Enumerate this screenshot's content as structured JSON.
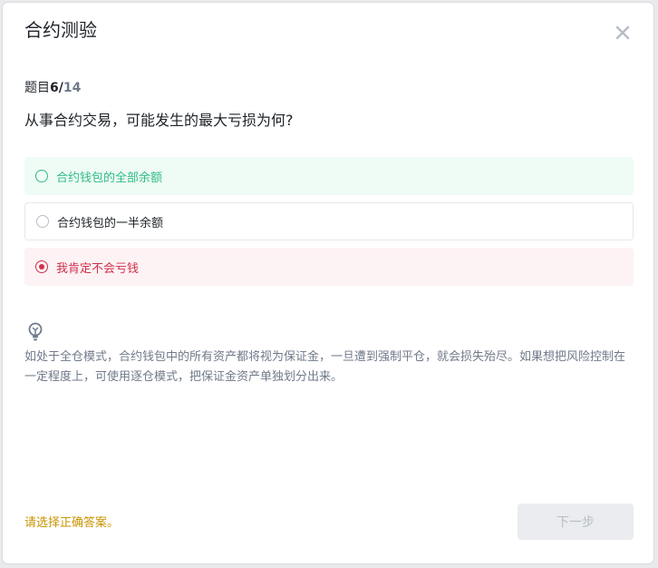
{
  "modal": {
    "title": "合约测验",
    "close_icon": "close-icon"
  },
  "progress": {
    "label": "题目",
    "current": "6",
    "separator": "/",
    "total": "14"
  },
  "question": "从事合约交易，可能发生的最大亏损为何?",
  "options": [
    {
      "label": "合约钱包的全部余额",
      "state": "correct"
    },
    {
      "label": "合约钱包的一半余额",
      "state": "normal"
    },
    {
      "label": "我肯定不会亏钱",
      "state": "selected-wrong"
    }
  ],
  "explanation": {
    "icon": "lightbulb-icon",
    "text": "如处于全仓模式，合约钱包中的所有资产都将视为保证金，一旦遭到强制平仓，就会损失殆尽。如果想把风险控制在一定程度上，可使用逐仓模式，把保证金资产单独划分出来。"
  },
  "footer": {
    "hint": "请选择正确答案。",
    "next_label": "下一步"
  },
  "colors": {
    "correct": "#2ebd85",
    "wrong": "#cf304a",
    "hint": "#c99400"
  }
}
